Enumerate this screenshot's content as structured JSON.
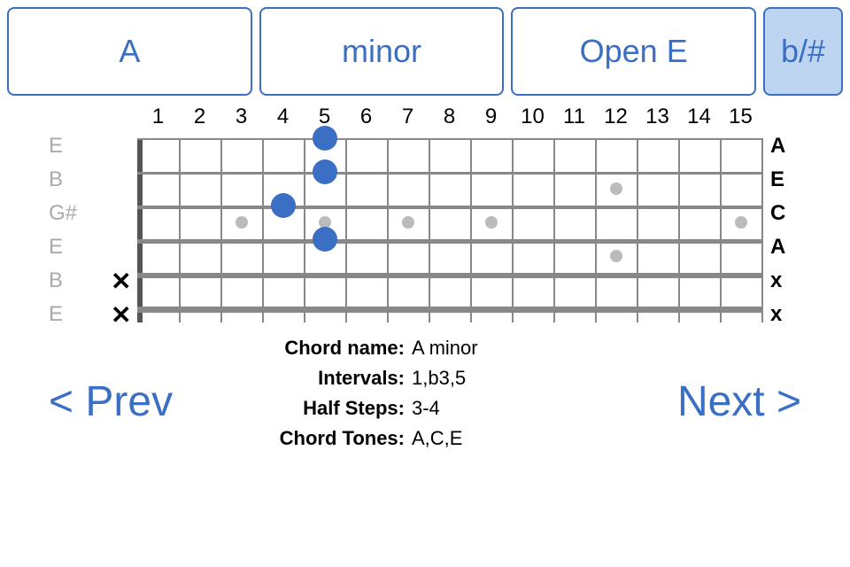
{
  "selectors": {
    "root": "A",
    "quality": "minor",
    "tuning": "Open E",
    "accidental": "b/#"
  },
  "fretboard": {
    "fret_count": 15,
    "fret_numbers": [
      "1",
      "2",
      "3",
      "4",
      "5",
      "6",
      "7",
      "8",
      "9",
      "10",
      "11",
      "12",
      "13",
      "14",
      "15"
    ],
    "strings_left": [
      "E",
      "B",
      "G#",
      "E",
      "B",
      "E"
    ],
    "strings_right": [
      "A",
      "E",
      "C",
      "A",
      "x",
      "x"
    ],
    "muted_strings": [
      4,
      5
    ],
    "inlays_single": [
      3,
      5,
      7,
      9,
      15
    ],
    "inlays_double": [
      12
    ],
    "finger_positions": [
      {
        "string": 0,
        "fret": 5
      },
      {
        "string": 1,
        "fret": 5
      },
      {
        "string": 2,
        "fret": 4
      },
      {
        "string": 3,
        "fret": 5
      }
    ]
  },
  "info": {
    "chord_name_label": "Chord name:",
    "chord_name_value": "A minor",
    "intervals_label": "Intervals:",
    "intervals_value": "1,b3,5",
    "half_steps_label": "Half Steps:",
    "half_steps_value": "3-4",
    "chord_tones_label": "Chord Tones:",
    "chord_tones_value": "A,C,E"
  },
  "nav": {
    "prev": "< Prev",
    "next": "Next >"
  }
}
